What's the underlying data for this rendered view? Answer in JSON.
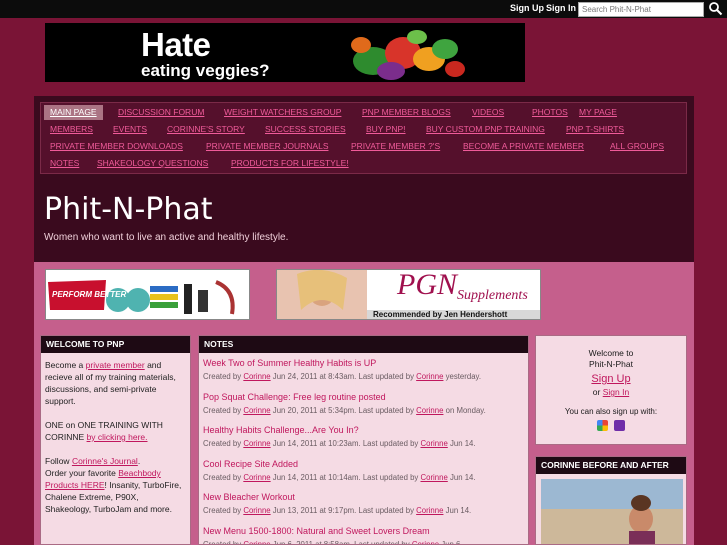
{
  "topbar": {
    "sign_up": "Sign Up",
    "sign_in": "Sign In",
    "search_placeholder": "Search Phit-N-Phat",
    "search_icon": "magnifier-icon"
  },
  "banner": {
    "line1": "Hate",
    "line2": "eating veggies?"
  },
  "nav": {
    "items": [
      {
        "label": "Main Page",
        "active": true
      },
      {
        "label": "Discussion Forum"
      },
      {
        "label": "Weight Watchers Group"
      },
      {
        "label": "PNP Member Blogs"
      },
      {
        "label": "Videos"
      },
      {
        "label": "Photos"
      },
      {
        "label": "My Page"
      },
      {
        "label": "Members"
      },
      {
        "label": "Events"
      },
      {
        "label": "Corinne's Story"
      },
      {
        "label": "Success Stories"
      },
      {
        "label": "Buy PNP!"
      },
      {
        "label": "Buy Custom PNP Training"
      },
      {
        "label": "PNP T-Shirts"
      },
      {
        "label": "Private Member Downloads"
      },
      {
        "label": "Private Member Journals"
      },
      {
        "label": "Private Member ?'s"
      },
      {
        "label": "Become a Private Member"
      },
      {
        "label": "All Groups"
      },
      {
        "label": "Notes"
      },
      {
        "label": "Shakeology Questions"
      },
      {
        "label": "Products for Lifestyle!"
      }
    ]
  },
  "site": {
    "title": "Phit-N-Phat",
    "tagline": "Women who want to live an active and healthy lifestyle."
  },
  "ads": {
    "perform_better": "PERFORM BETTER",
    "pgn_text": "PGN",
    "supplements": "Supplements",
    "recommended": "Recommended by Jen Hendershott"
  },
  "welcome": {
    "heading": "Welcome to PNP",
    "p1_pre": "Become a ",
    "p1_link": "private member",
    "p1_post": " and recieve all of my training materials, discussions, and semi-private support.",
    "p2_pre": "ONE on ONE TRAINING WITH CORINNE ",
    "p2_link": "by clicking here.",
    "p3_pre": "Follow ",
    "p3_link": "Corinne's Journal",
    "p3_post": ".",
    "p4_pre": "Order your favorite ",
    "p4_link": "Beachbody Products HERE",
    "p4_post": "! Insanity, TurboFire, Chalene Extreme, P90X, Shakeology, TurboJam and more."
  },
  "notes": {
    "heading": "Notes",
    "items": [
      {
        "title": "Week Two of Summer Healthy Habits is UP",
        "created": "Created by",
        "author": "Corinne",
        "date": "Jun 24, 2011 at 8:43am. Last updated by",
        "updater": "Corinne",
        "updated": "yesterday."
      },
      {
        "title": "Pop Squat Challenge: Free leg routine posted",
        "created": "Created by",
        "author": "Corinne",
        "date": "Jun 20, 2011 at 5:34pm. Last updated by",
        "updater": "Corinne",
        "updated": "on Monday."
      },
      {
        "title": "Healthy Habits Challenge...Are You In?",
        "created": "Created by",
        "author": "Corinne",
        "date": "Jun 14, 2011 at 10:23am. Last updated by",
        "updater": "Corinne",
        "updated": "Jun 14."
      },
      {
        "title": "Cool Recipe Site Added",
        "created": "Created by",
        "author": "Corinne",
        "date": "Jun 14, 2011 at 10:14am. Last updated by",
        "updater": "Corinne",
        "updated": "Jun 14."
      },
      {
        "title": "New Bleacher Workout",
        "created": "Created by",
        "author": "Corinne",
        "date": "Jun 13, 2011 at 9:17pm. Last updated by",
        "updater": "Corinne",
        "updated": "Jun 14."
      },
      {
        "title": "New Menu 1500-1800: Natural and Sweet Lovers Dream",
        "created": "Created by",
        "author": "Corinne",
        "date": "Jun 6, 2011 at 8:58am. Last updated by",
        "updater": "Corinne",
        "updated": "Jun 6."
      }
    ]
  },
  "signbox": {
    "welcome_line1": "Welcome to",
    "welcome_line2": "Phit-N-Phat",
    "sign_up": "Sign Up",
    "or": "or",
    "sign_in": "Sign In",
    "also": "You can also sign up with:"
  },
  "before_after": {
    "heading": "Corinne Before and After"
  }
}
